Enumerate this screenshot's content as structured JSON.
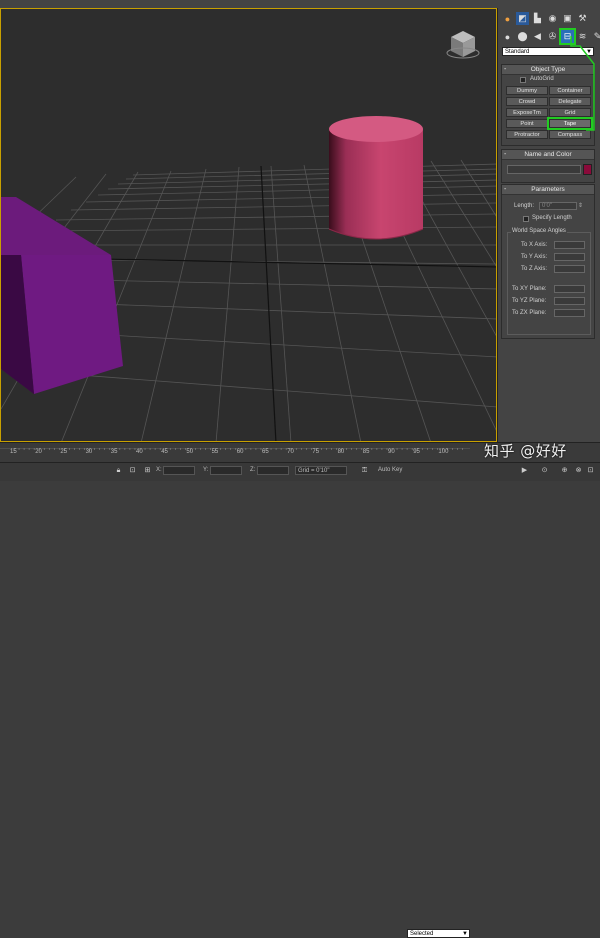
{
  "command_panel": {
    "tabs_row1": [
      "create-icon",
      "modify-icon",
      "hierarchy-icon",
      "motion-icon",
      "display-icon",
      "utilities-icon"
    ],
    "tabs_row2": [
      "geometry-icon",
      "shapes-icon",
      "lights-icon",
      "cameras-icon",
      "helpers-icon",
      "spacewarps-icon",
      "systems-icon"
    ],
    "category_value": "Standard",
    "object_type": {
      "title": "Object Type",
      "autogrid_label": "AutoGrid",
      "buttons": [
        "Dummy",
        "Container",
        "Crowd",
        "Delegate",
        "ExposeTm",
        "Grid",
        "Point",
        "Tape",
        "Protractor",
        "Compass"
      ]
    },
    "name_and_color": {
      "title": "Name and Color",
      "name_value": "",
      "swatch_color": "#8a0a3a"
    },
    "parameters": {
      "title": "Parameters",
      "length_label": "Length:",
      "length_value": "0'0\"",
      "specify_length_label": "Specify Length",
      "group_title": "World Space Angles",
      "axis_labels": [
        "To X Axis:",
        "To Y Axis:",
        "To Z Axis:"
      ],
      "plane_labels": [
        "To XY Plane:",
        "To YZ Plane:",
        "To ZX Plane:"
      ]
    }
  },
  "timeline": {
    "ticks": [
      "15",
      "20",
      "25",
      "30",
      "35",
      "40",
      "45",
      "50",
      "55",
      "60",
      "65",
      "70",
      "75",
      "80",
      "85",
      "90",
      "95",
      "100"
    ]
  },
  "statusbar": {
    "x_label": "X:",
    "y_label": "Y:",
    "z_label": "Z:",
    "grid_text": "Grid = 0'10\"",
    "autokey_label": "Auto Key",
    "selected_value": "Selected"
  },
  "watermark": "知乎 @好好",
  "colors": {
    "cylinder": "#c0406a",
    "box": "#6a1a78",
    "selection_highlight": "#22cc22",
    "viewport_border": "#c8a000"
  }
}
